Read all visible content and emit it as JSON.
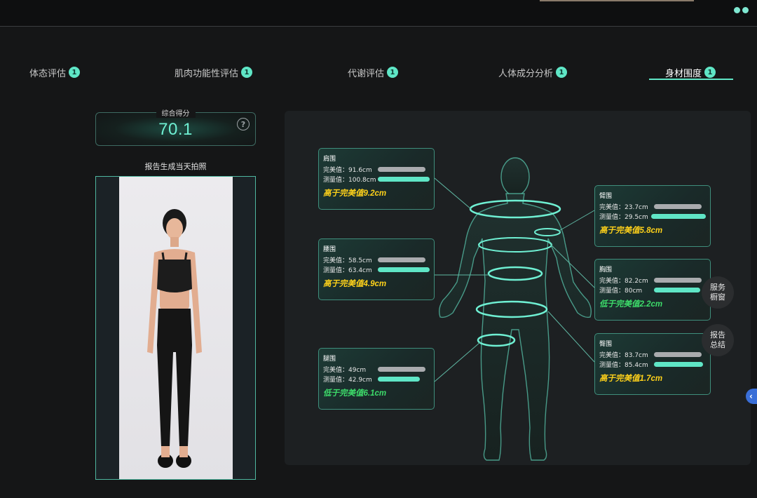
{
  "tabs": [
    {
      "label": "体态评估",
      "badge": "1"
    },
    {
      "label": "肌肉功能性评估",
      "badge": "1"
    },
    {
      "label": "代谢评估",
      "badge": "1"
    },
    {
      "label": "人体成分分析",
      "badge": "1"
    },
    {
      "label": "身材围度",
      "badge": "1",
      "active": true
    }
  ],
  "score": {
    "label": "综合得分",
    "value": "70.1"
  },
  "photo": {
    "title": "报告生成当天拍照"
  },
  "measurements": [
    {
      "title": "肩围",
      "ideal_label": "完美值：",
      "ideal_value": "91.6cm",
      "measured_label": "测量值：",
      "measured_value": "100.8cm",
      "verdict": "高于完美值9.2cm",
      "direction": "high"
    },
    {
      "title": "腰围",
      "ideal_label": "完美值：",
      "ideal_value": "58.5cm",
      "measured_label": "测量值：",
      "measured_value": "63.4cm",
      "verdict": "高于完美值4.9cm",
      "direction": "high"
    },
    {
      "title": "腿围",
      "ideal_label": "完美值：",
      "ideal_value": "49cm",
      "measured_label": "测量值：",
      "measured_value": "42.9cm",
      "verdict": "低于完美值6.1cm",
      "direction": "low"
    },
    {
      "title": "臂围",
      "ideal_label": "完美值：",
      "ideal_value": "23.7cm",
      "measured_label": "测量值：",
      "measured_value": "29.5cm",
      "verdict": "高于完美值5.8cm",
      "direction": "high"
    },
    {
      "title": "胸围",
      "ideal_label": "完美值：",
      "ideal_value": "82.2cm",
      "measured_label": "测量值：",
      "measured_value": "80cm",
      "verdict": "低于完美值2.2cm",
      "direction": "low"
    },
    {
      "title": "臀围",
      "ideal_label": "完美值：",
      "ideal_value": "83.7cm",
      "measured_label": "测量值：",
      "measured_value": "85.4cm",
      "verdict": "高于完美值1.7cm",
      "direction": "high"
    }
  ],
  "float_buttons": {
    "service": "服务\n橱窗",
    "summary": "报告\n总结"
  },
  "colors": {
    "accent": "#5fe6c6",
    "high": "#ffd21a",
    "low": "#3ddc6a",
    "ideal_bar": "#a9abae"
  },
  "icons": {
    "help": "question-circle-icon",
    "collapse": "chevron-left-icon"
  }
}
